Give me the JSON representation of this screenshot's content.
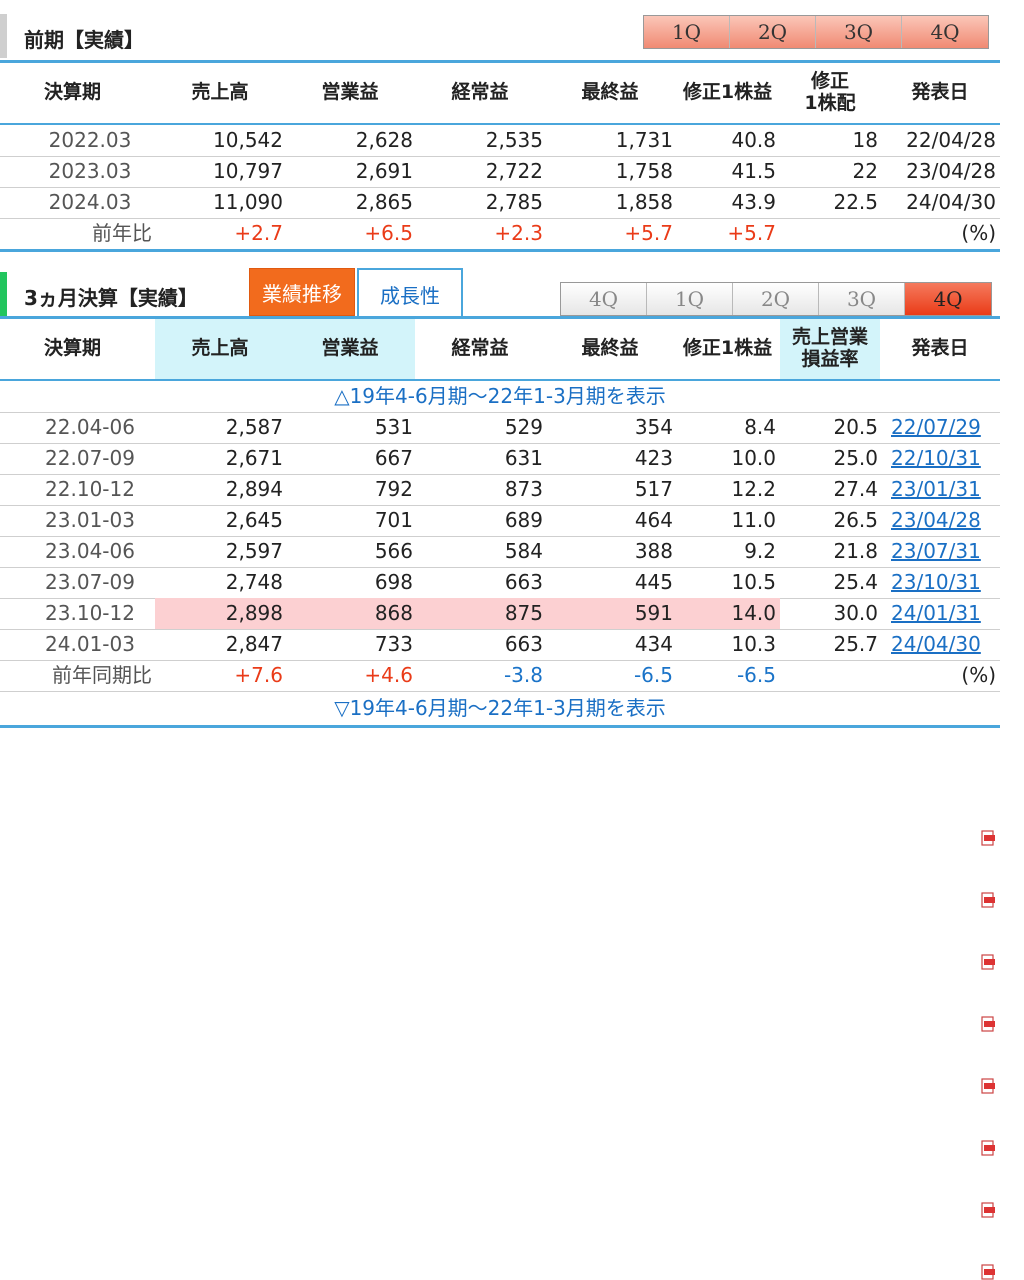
{
  "annual": {
    "title": "前期【実績】",
    "quarter_buttons": [
      "1Q",
      "2Q",
      "3Q",
      "4Q"
    ],
    "headers": [
      "決算期",
      "売上高",
      "営業益",
      "経常益",
      "最終益",
      "修正1株益",
      "修正\n1株配",
      "発表日"
    ],
    "rows": [
      {
        "period": "2022.03",
        "sales": "10,542",
        "op": "2,628",
        "ord": "2,535",
        "net": "1,731",
        "eps": "40.8",
        "div": "18",
        "date": "22/04/28"
      },
      {
        "period": "2023.03",
        "sales": "10,797",
        "op": "2,691",
        "ord": "2,722",
        "net": "1,758",
        "eps": "41.5",
        "div": "22",
        "date": "23/04/28"
      },
      {
        "period": "2024.03",
        "sales": "11,090",
        "op": "2,865",
        "ord": "2,785",
        "net": "1,858",
        "eps": "43.9",
        "div": "22.5",
        "date": "24/04/30"
      }
    ],
    "yoy": {
      "label": "前年比",
      "sales": "+2.7",
      "op": "+6.5",
      "ord": "+2.3",
      "net": "+5.7",
      "eps": "+5.7",
      "unit": "(%)"
    }
  },
  "quarterly": {
    "title": "3ヵ月決算【実績】",
    "tabs": [
      {
        "label": "業績推移",
        "active": true
      },
      {
        "label": "成長性",
        "active": false
      }
    ],
    "quarter_buttons": [
      {
        "label": "4Q",
        "active": false
      },
      {
        "label": "1Q",
        "active": false
      },
      {
        "label": "2Q",
        "active": false
      },
      {
        "label": "3Q",
        "active": false
      },
      {
        "label": "4Q",
        "active": true
      }
    ],
    "headers": [
      "決算期",
      "売上高",
      "営業益",
      "経常益",
      "最終益",
      "修正1株益",
      "売上営業\n損益率",
      "発表日"
    ],
    "show_earlier": "△19年4-6月期～22年1-3月期を表示",
    "show_earlier_bottom": "▽19年4-6月期～22年1-3月期を表示",
    "rows": [
      {
        "period": "22.04-06",
        "sales": "2,587",
        "op": "531",
        "ord": "529",
        "net": "354",
        "eps": "8.4",
        "margin": "20.5",
        "date": "22/07/29"
      },
      {
        "period": "22.07-09",
        "sales": "2,671",
        "op": "667",
        "ord": "631",
        "net": "423",
        "eps": "10.0",
        "margin": "25.0",
        "date": "22/10/31"
      },
      {
        "period": "22.10-12",
        "sales": "2,894",
        "op": "792",
        "ord": "873",
        "net": "517",
        "eps": "12.2",
        "margin": "27.4",
        "date": "23/01/31"
      },
      {
        "period": "23.01-03",
        "sales": "2,645",
        "op": "701",
        "ord": "689",
        "net": "464",
        "eps": "11.0",
        "margin": "26.5",
        "date": "23/04/28"
      },
      {
        "period": "23.04-06",
        "sales": "2,597",
        "op": "566",
        "ord": "584",
        "net": "388",
        "eps": "9.2",
        "margin": "21.8",
        "date": "23/07/31"
      },
      {
        "period": "23.07-09",
        "sales": "2,748",
        "op": "698",
        "ord": "663",
        "net": "445",
        "eps": "10.5",
        "margin": "25.4",
        "date": "23/10/31"
      },
      {
        "period": "23.10-12",
        "sales": "2,898",
        "op": "868",
        "ord": "875",
        "net": "591",
        "eps": "14.0",
        "margin": "30.0",
        "date": "24/01/31",
        "highlight": true
      },
      {
        "period": "24.01-03",
        "sales": "2,847",
        "op": "733",
        "ord": "663",
        "net": "434",
        "eps": "10.3",
        "margin": "25.7",
        "date": "24/04/30"
      }
    ],
    "yoy": {
      "label": "前年同期比",
      "sales": "+7.6",
      "op": "+4.6",
      "ord": "-3.8",
      "net": "-6.5",
      "eps": "-6.5",
      "unit": "(%)"
    }
  },
  "colors": {
    "accent_blue": "#4aa6dc",
    "tab_orange": "#f26b1d",
    "button_active": "#ea3b18",
    "positive": "#ea3b18",
    "negative": "#1a73c8",
    "highlight_blue": "#d3f4fa",
    "highlight_red": "#fcd0d2"
  },
  "icons": {
    "pdf": "pdf-icon"
  }
}
